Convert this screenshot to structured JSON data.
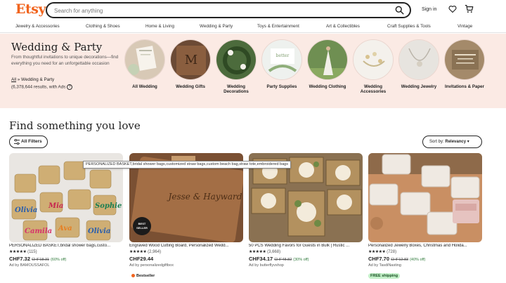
{
  "header": {
    "logo": "Etsy",
    "search_placeholder": "Search for anything",
    "signin": "Sign in"
  },
  "categories": [
    "Jewelry & Accessories",
    "Clothing & Shoes",
    "Home & Living",
    "Wedding & Party",
    "Toys & Entertainment",
    "Art & Collectibles",
    "Craft Supplies & Tools",
    "Vintage"
  ],
  "hero": {
    "title": "Wedding & Party",
    "description": "From thoughtful invitations to unique decorations—find everything you need for an unforgettable occasion",
    "crumb_all": "All",
    "crumb_sep": "»",
    "crumb_current": "Wedding & Party",
    "results": "(6,378,644 results, with Ads",
    "circles": [
      {
        "label": "All Wedding"
      },
      {
        "label": "Wedding Gifts"
      },
      {
        "label": "Wedding Decorations"
      },
      {
        "label": "Party Supplies"
      },
      {
        "label": "Wedding Clothing"
      },
      {
        "label": "Wedding Accessories"
      },
      {
        "label": "Wedding Jewelry"
      },
      {
        "label": "Invitations & Paper"
      }
    ]
  },
  "section": {
    "title": "Find something you love",
    "filters": "All Filters",
    "sort_prefix": "Sort by:",
    "sort_value": "Relevancy"
  },
  "tooltip": "PERSONALIZED BASKET,bridal shower bags,customized straw bags,custom beach bag,straw tote,embroidered bags",
  "listings": [
    {
      "title": "PERSONALIZED BASKET,bridal shower bags,custo...",
      "stars": "★★★★★",
      "reviews": "(115)",
      "price": "CHF7.32",
      "orig": "CHF18.31",
      "pct": "(60% off)",
      "shop": "Ad by BAMOUSSAFOL",
      "badge": ""
    },
    {
      "title": "Engraved Wood Cutting Board, Personalized Wedd...",
      "stars": "★★★★★",
      "reviews": "(2,964)",
      "price": "CHF29.44",
      "orig": "",
      "pct": "",
      "shop": "Ad by personalizedgiftbox",
      "badge": "Bestseller"
    },
    {
      "title": "50 PCS Wedding Favors for Guests in Bulk | Rustic ...",
      "stars": "★★★★★",
      "reviews": "(3,668)",
      "price": "CHF34.17",
      "orig": "CHF48.82",
      "pct": "(30% off)",
      "shop": "Ad by butterflyvshop",
      "badge": ""
    },
    {
      "title": "Personalized Jewelry Boxes, Christmas and Holida...",
      "stars": "★★★★★",
      "reviews": "(728)",
      "price": "CHF7.70",
      "orig": "CHF12.83",
      "pct": "(40% off)",
      "shop": "Ad by TasdiNasting",
      "badge": "FREE shipping"
    }
  ],
  "colors": {
    "accent": "#f1641e",
    "hero_bg": "#fbeae4",
    "sale_green": "#2f7a3b"
  }
}
